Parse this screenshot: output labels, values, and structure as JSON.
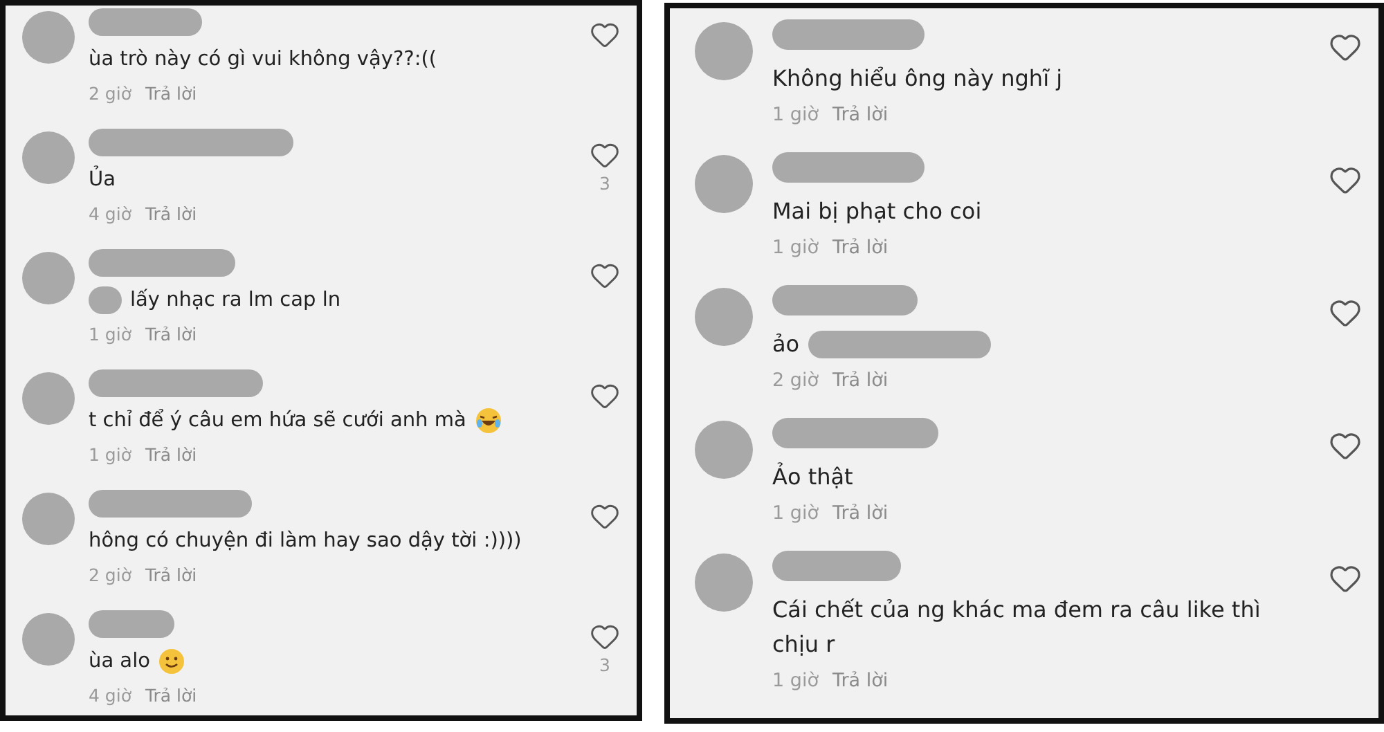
{
  "panels": [
    {
      "comments": [
        {
          "kind": "plain",
          "text": "ùa trò này có gì vui không vậy??:((",
          "time": "2 giờ",
          "reply": "Trả lời"
        },
        {
          "kind": "plain",
          "text": "Ủa",
          "time": "4 giờ",
          "reply": "Trả lời",
          "likes": "3"
        },
        {
          "kind": "mention_first",
          "text": "lấy nhạc ra lm cap ln",
          "time": "1 giờ",
          "reply": "Trả lời"
        },
        {
          "kind": "laughing_emoji",
          "text": "t chỉ để ý câu em hứa sẽ cưới anh mà",
          "time": "1 giờ",
          "reply": "Trả lời"
        },
        {
          "kind": "plain",
          "text": "hông có chuyện đi làm hay sao dậy tời :))))",
          "time": "2 giờ",
          "reply": "Trả lời"
        },
        {
          "kind": "smiling_emoji",
          "text": "ùa alo",
          "time": "4 giờ",
          "reply": "Trả lời",
          "likes": "3"
        }
      ]
    },
    {
      "comments": [
        {
          "kind": "plain",
          "text": "Không hiểu ông này nghĩ j",
          "time": "1 giờ",
          "reply": "Trả lời"
        },
        {
          "kind": "plain",
          "text": "Mai bị phạt cho coi",
          "time": "1 giờ",
          "reply": "Trả lời"
        },
        {
          "kind": "mention_last",
          "text": "ảo",
          "time": "2 giờ",
          "reply": "Trả lời"
        },
        {
          "kind": "plain",
          "text": "Ảo thật",
          "time": "1 giờ",
          "reply": "Trả lời"
        },
        {
          "kind": "plain",
          "text": "Cái chết của ng khác ma đem ra câu like thì chịu r",
          "time": "1 giờ",
          "reply": "Trả lời"
        }
      ]
    }
  ]
}
